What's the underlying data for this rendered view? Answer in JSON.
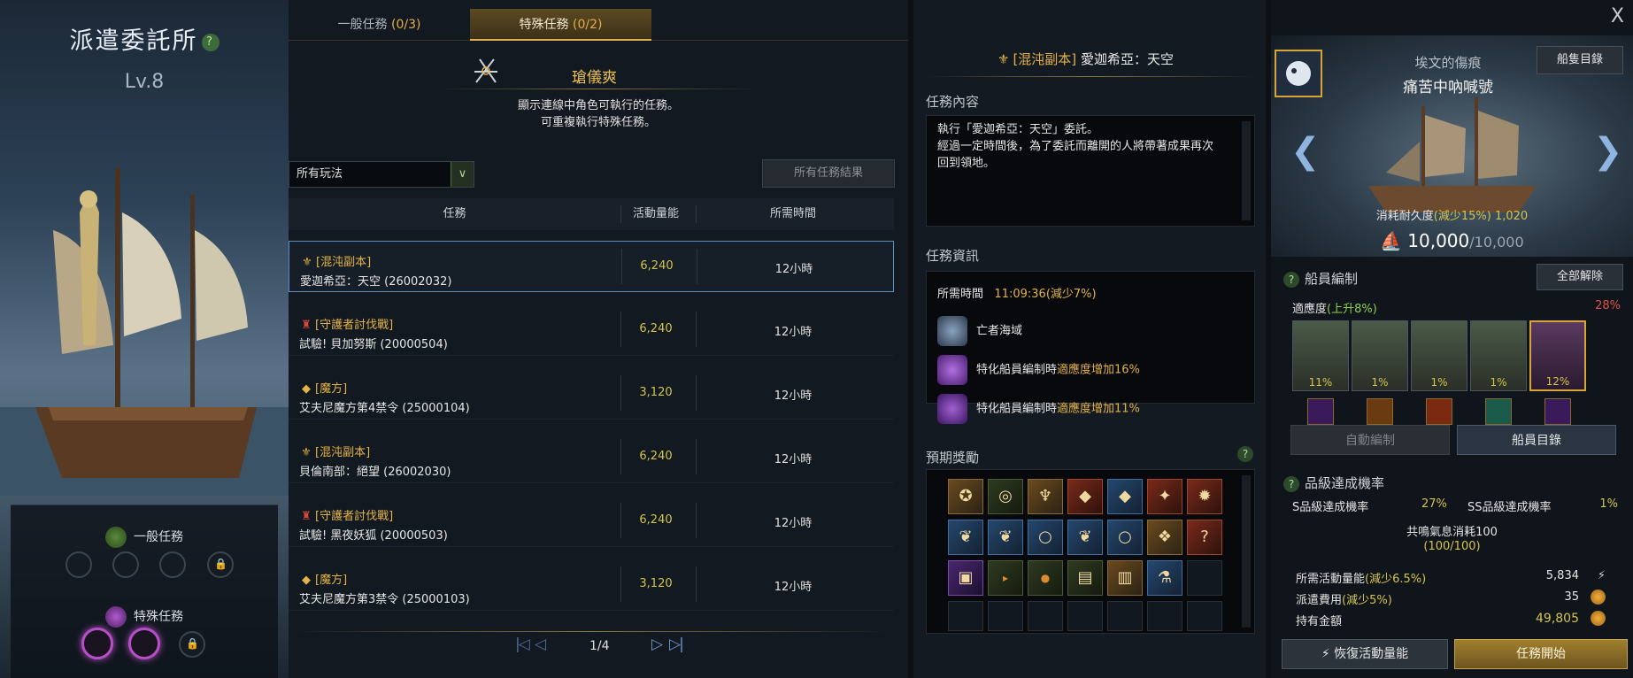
{
  "left": {
    "title": "派遣委託所",
    "help": "?",
    "level": "Lv.8",
    "general_tasks_label": "一般任務",
    "special_tasks_label": "特殊任務"
  },
  "tabs": [
    {
      "label": "一般任務",
      "count": "(0/3)"
    },
    {
      "label": "特殊任務",
      "count": "(0/2)"
    }
  ],
  "character": {
    "name": "瑲儀爽",
    "desc_line1": "顯示連線中角色可執行的任務。",
    "desc_line2": "可重複執行特殊任務。"
  },
  "filter": {
    "selected": "所有玩法",
    "results_button": "所有任務結果"
  },
  "table": {
    "headers": [
      "任務",
      "活動量能",
      "所需時間"
    ],
    "rows": [
      {
        "category": "[混沌副本]",
        "cat_icon": "chaos-icon",
        "name": "愛迦希亞：天空 (26002032)",
        "energy": "6,240",
        "time": "12小時"
      },
      {
        "category": "[守護者討伐戰]",
        "cat_icon": "guardian-icon",
        "name": "試驗! 貝加努斯 (20000504)",
        "energy": "6,240",
        "time": "12小時"
      },
      {
        "category": "[魔方]",
        "cat_icon": "cube-icon",
        "name": "艾夫尼魔方第4禁令 (25000104)",
        "energy": "3,120",
        "time": "12小時"
      },
      {
        "category": "[混沌副本]",
        "cat_icon": "chaos-icon",
        "name": "貝倫南部：絕望 (26002030)",
        "energy": "6,240",
        "time": "12小時"
      },
      {
        "category": "[守護者討伐戰]",
        "cat_icon": "guardian-icon",
        "name": "試驗! 黑夜妖狐 (20000503)",
        "energy": "6,240",
        "time": "12小時"
      },
      {
        "category": "[魔方]",
        "cat_icon": "cube-icon",
        "name": "艾夫尼魔方第3禁令 (25000103)",
        "energy": "3,120",
        "time": "12小時"
      }
    ]
  },
  "pager": {
    "page": "1/4"
  },
  "detail": {
    "tag": "[混沌副本]",
    "title": "愛迦希亞：天空",
    "content_header": "任務內容",
    "content_line1": "執行「愛迦希亞：天空」委託。",
    "content_line2": "經過一定時間後，為了委託而離開的人將帶著成果再次",
    "content_line3": "回到領地。",
    "info_header": "任務資訊",
    "time_label": "所需時間",
    "time_value": "11:09:36",
    "time_reduce": "(減少7%)",
    "area": "亡者海域",
    "bonus1_prefix": "特化船員編制時",
    "bonus1_hl": "適應度增加16%",
    "bonus2_prefix": "特化船員編制時",
    "bonus2_hl": "適應度增加11%",
    "reward_header": "預期獎勵",
    "help": "?"
  },
  "ship": {
    "subtitle": "埃文的傷痕",
    "name": "痛苦中吶喊號",
    "list_button": "船隻目錄",
    "durability_label": "消耗耐久度",
    "durability_reduce": "(減少15%)",
    "durability_cost": "1,020",
    "durability_current": "10,000",
    "durability_max": "/10,000"
  },
  "crew": {
    "header": "船員編制",
    "unassign_button": "全部解除",
    "adapt_label": "適應度",
    "adapt_bonus": "(上升8%)",
    "adapt_total": "28%",
    "members": [
      "11%",
      "1%",
      "1%",
      "1%",
      "12%"
    ],
    "auto_button": "自動編制",
    "list_button": "船員目錄"
  },
  "grade": {
    "header": "品級達成機率",
    "s_label": "S品級達成機率",
    "s_value": "27%",
    "ss_label": "SS品級達成機率",
    "ss_value": "1%",
    "resonance": "共鳴氣息消耗100",
    "resonance_count": "(100/100)"
  },
  "costs": {
    "energy_label": "所需活動量能",
    "energy_reduce": "(減少6.5%)",
    "energy_value": "5,834",
    "fee_label": "派遣費用",
    "fee_reduce": "(減少5%)",
    "fee_value": "35",
    "gold_label": "持有金額",
    "gold_value": "49,805"
  },
  "buttons": {
    "restore": "恢復活動量能",
    "start": "任務開始",
    "close": "X"
  },
  "colors": {
    "accent_gold": "#e3b348",
    "highlight_yellow": "#d3c44a",
    "selection_blue": "#5a8ec2"
  }
}
